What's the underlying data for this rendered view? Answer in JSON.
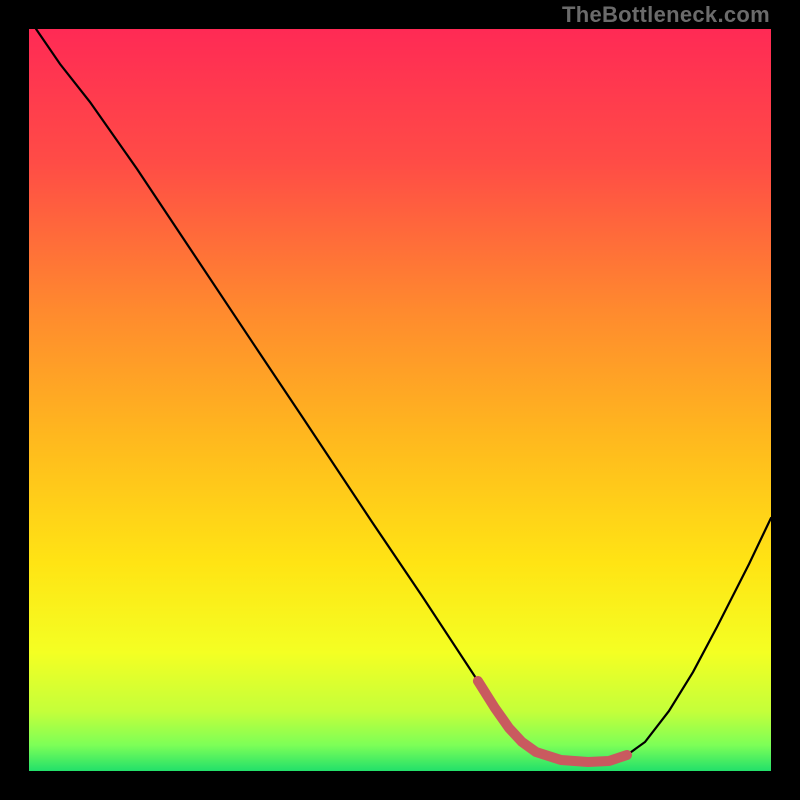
{
  "watermark": "TheBottleneck.com",
  "chart_data": {
    "type": "line",
    "title": "",
    "xlabel": "",
    "ylabel": "",
    "xlim": [
      0,
      100
    ],
    "ylim": [
      0,
      100
    ],
    "grid": false,
    "legend": false,
    "series": [
      {
        "name": "curve",
        "x": [
          0.95,
          4.18,
          8.22,
          14.56,
          21.56,
          30.98,
          36.93,
          46.23,
          52.97,
          60.23,
          62.79,
          64.69,
          66.44,
          68.33,
          71.7,
          75.34,
          78.17,
          80.59,
          83.02,
          86.25,
          89.49,
          92.72,
          97.04,
          100.0
        ],
        "y": [
          100.0,
          95.28,
          90.16,
          81.13,
          70.62,
          56.47,
          47.57,
          33.56,
          23.59,
          12.53,
          8.49,
          5.8,
          3.91,
          2.56,
          1.48,
          1.21,
          1.35,
          2.16,
          3.91,
          8.09,
          13.34,
          19.41,
          27.9,
          34.1
        ]
      }
    ],
    "highlight_segment": {
      "color": "#c95a5f",
      "x": [
        60.5,
        62.79,
        64.69,
        66.44,
        68.33,
        71.7,
        75.34,
        78.17,
        80.59
      ],
      "y": [
        12.13,
        8.49,
        5.8,
        3.91,
        2.56,
        1.48,
        1.21,
        1.35,
        2.16
      ]
    },
    "gradient_stops": [
      {
        "offset": 0.0,
        "color": "#ff2a55"
      },
      {
        "offset": 0.18,
        "color": "#ff4c46"
      },
      {
        "offset": 0.38,
        "color": "#ff8a2e"
      },
      {
        "offset": 0.55,
        "color": "#ffb81e"
      },
      {
        "offset": 0.72,
        "color": "#ffe414"
      },
      {
        "offset": 0.84,
        "color": "#f4ff23"
      },
      {
        "offset": 0.92,
        "color": "#c4ff3a"
      },
      {
        "offset": 0.965,
        "color": "#7dff57"
      },
      {
        "offset": 1.0,
        "color": "#22e06a"
      }
    ]
  }
}
